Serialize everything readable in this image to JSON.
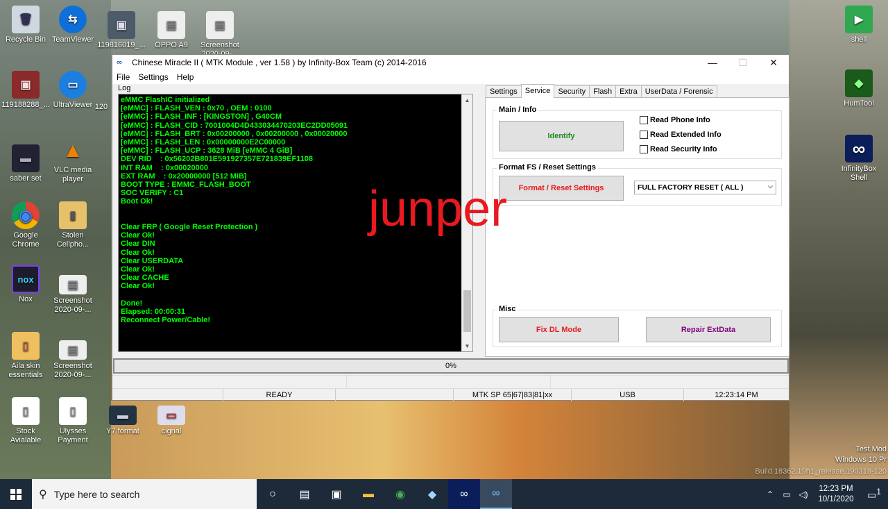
{
  "desktop_icons": [
    {
      "label": "Recycle Bin",
      "glyph": "🗑"
    },
    {
      "label": "TeamViewer",
      "glyph": "⇆"
    },
    {
      "label": "119816019_...",
      "glyph": "▣"
    },
    {
      "label": "OPPO A9",
      "glyph": "▤"
    },
    {
      "label": "Screenshot 2020-09-...",
      "glyph": "▤"
    },
    {
      "label": "119188288_...",
      "glyph": "▣"
    },
    {
      "label": "UltraViewer",
      "glyph": "▭"
    },
    {
      "label": "120",
      "glyph": ""
    },
    {
      "label": "saber set",
      "glyph": "▬"
    },
    {
      "label": "VLC media player",
      "glyph": "▲"
    },
    {
      "label": "Google Chrome",
      "glyph": "◉"
    },
    {
      "label": "Stolen Cellpho...",
      "glyph": "▮"
    },
    {
      "label": "Nox",
      "glyph": "nox"
    },
    {
      "label": "Screenshot 2020-09-...",
      "glyph": "▤"
    },
    {
      "label": "Aila skin essentials",
      "glyph": "▯"
    },
    {
      "label": "Screenshot 2020-09-...",
      "glyph": "▤"
    },
    {
      "label": "Stock Avialable",
      "glyph": "▯"
    },
    {
      "label": "Ulysses Payment",
      "glyph": "▯"
    },
    {
      "label": "Y7 format",
      "glyph": "▬"
    },
    {
      "label": "cignal",
      "glyph": "▭"
    },
    {
      "label": "shell",
      "glyph": "▶"
    },
    {
      "label": "HumTool",
      "glyph": "◆"
    },
    {
      "label": "InfinityBox Shell",
      "glyph": "∞"
    }
  ],
  "window": {
    "title": "Chinese Miracle II ( MTK Module , ver 1.58 ) by Infinity-Box Team (c) 2014-2016",
    "app_icon": "∞",
    "minimize": "—",
    "maximize": "☐",
    "close": "✕"
  },
  "menu": {
    "file": "File",
    "settings": "Settings",
    "help": "Help"
  },
  "log": {
    "label": "Log",
    "text": "eMMC FlashIC initialized\n[eMMC] : FLASH_VEN : 0x70 , OEM : 0100\n[eMMC] : FLASH_INF : [KINGSTON] , G40CM\n[eMMC] : FLASH_CID : 7001004D4D433034470203EC2DD05091\n[eMMC] : FLASH_BRT : 0x00200000 , 0x00200000 , 0x00020000\n[eMMC] : FLASH_LEN : 0x00000000E2C00000\n[eMMC] : FLASH_UCP : 3628 MiB [eMMC 4 GiB]\nDEV RID    : 0x56202B801E591927357E721839EF1108\nINT RAM    : 0x00020000\nEXT RAM    : 0x20000000 [512 MiB]\nBOOT TYPE : EMMC_FLASH_BOOT\nSOC VERIFY : C1\nBoot Ok!\n\n\nClear FRP ( Google Reset Protection )\nClear Ok!\nClear DIN\nClear Ok!\nClear USERDATA\nClear Ok!\nClear CACHE\nClear Ok!\n\nDone!\nElapsed: 00:00:31\nReconnect Power/Cable!"
  },
  "tabs": [
    "Settings",
    "Service",
    "Security",
    "Flash",
    "Extra",
    "UserData / Forensic"
  ],
  "service": {
    "main_info_title": "Main / Info",
    "identify_label": "Identify",
    "read_phone_info": "Read Phone Info",
    "read_extended_info": "Read Extended Info",
    "read_security_info": "Read Security Info",
    "format_title": "Format FS / Reset Settings",
    "format_label": "Format / Reset Settings",
    "format_option": "FULL FACTORY RESET ( ALL )",
    "misc_title": "Misc",
    "fix_dl_label": "Fix DL Mode",
    "repair_label": "Repair ExtData"
  },
  "progress": {
    "value": 0,
    "text": "0%"
  },
  "status": {
    "state": "READY",
    "sp": "MTK SP 65|67|83|81|xx",
    "port": "USB",
    "time": "12:23:14 PM"
  },
  "watermark": "junper",
  "system_watermark": {
    "line1": "Test Mod",
    "line2": "Windows 10 Pr",
    "line3": "Build 18362.19h1_release.190318-120"
  },
  "taskbar": {
    "search_placeholder": "Type here to search",
    "clock_time": "12:23 PM",
    "clock_date": "10/1/2020",
    "notification_count": "1"
  },
  "colors": {
    "log_bg": "#000000",
    "log_text": "#00ff00",
    "identify": "#1a8a1a",
    "format": "#e8191f",
    "fix_dl": "#e8191f",
    "repair": "#800080",
    "watermark": "#e8191f"
  }
}
